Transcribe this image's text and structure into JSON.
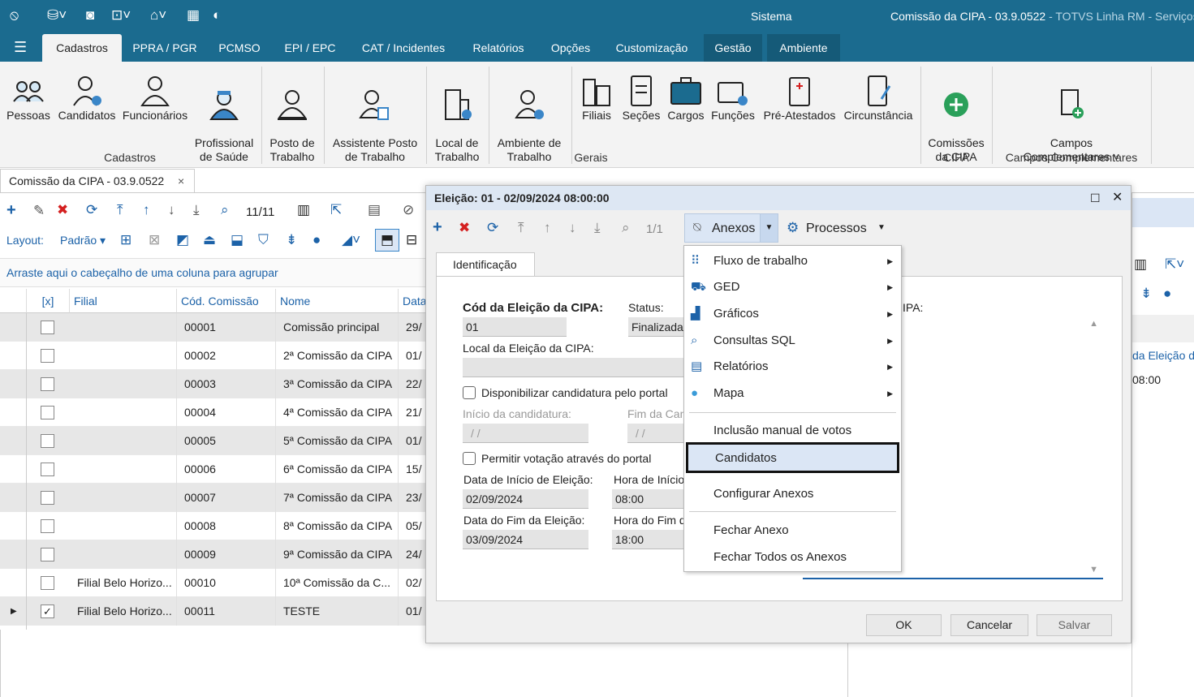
{
  "title_bar": {
    "center": "Sistema",
    "window_title": "Comissão da CIPA - 03.9.0522",
    "app_suffix": " - TOTVS Linha RM - Serviços"
  },
  "menu_tabs": [
    "Cadastros",
    "PPRA / PGR",
    "PCMSO",
    "EPI / EPC",
    "CAT / Incidentes",
    "Relatórios",
    "Opções",
    "Customização",
    "Gestão",
    "Ambiente"
  ],
  "ribbon": {
    "buttons": [
      {
        "label": "Pessoas",
        "icon": "people-icon"
      },
      {
        "label": "Candidatos",
        "icon": "candidate-icon"
      },
      {
        "label": "Funcionários",
        "icon": "employee-icon"
      },
      {
        "label": "Profissional\nde Saúde",
        "icon": "doctor-icon"
      },
      {
        "label": "Posto de\nTrabalho",
        "icon": "workstation-icon"
      },
      {
        "label": "Assistente Posto\nde Trabalho",
        "icon": "wizard-icon"
      },
      {
        "label": "Local de\nTrabalho",
        "icon": "building-icon"
      },
      {
        "label": "Ambiente de\nTrabalho",
        "icon": "environment-icon"
      },
      {
        "label": "Filiais",
        "icon": "branch-icon"
      },
      {
        "label": "Seções",
        "icon": "section-icon"
      },
      {
        "label": "Cargos",
        "icon": "briefcase-icon"
      },
      {
        "label": "Funções",
        "icon": "function-icon"
      },
      {
        "label": "Pré-Atestados",
        "icon": "certificate-icon"
      },
      {
        "label": "Circunstância",
        "icon": "circumstance-icon"
      },
      {
        "label": "Comissões\nda CIPA",
        "icon": "add-circle-icon"
      },
      {
        "label": "Campos\nComplementares ˅",
        "icon": "doc-plus-icon"
      }
    ],
    "groups": [
      "Cadastros",
      "Gerais",
      "CIPA",
      "Campos Complementares"
    ]
  },
  "doc_tab": {
    "label": "Comissão da CIPA - 03.9.0522",
    "close": "×"
  },
  "main_toolbar": {
    "counter": "11/11",
    "layout_label": "Layout:",
    "layout_value": "Padrão ▾"
  },
  "group_hint": "Arraste aqui o cabeçalho de uma coluna para agrupar",
  "grid": {
    "columns": [
      "[x]",
      "Filial",
      "Cód. Comissão",
      "Nome",
      "Data"
    ],
    "rows": [
      {
        "filial": "",
        "cod": "00001",
        "nome": "Comissão principal",
        "data": "29/",
        "checked": false
      },
      {
        "filial": "",
        "cod": "00002",
        "nome": "2ª Comissão da CIPA",
        "data": "01/",
        "checked": false
      },
      {
        "filial": "",
        "cod": "00003",
        "nome": "3ª Comissão da CIPA",
        "data": "22/",
        "checked": false
      },
      {
        "filial": "",
        "cod": "00004",
        "nome": "4ª Comissão da CIPA",
        "data": "21/",
        "checked": false
      },
      {
        "filial": "",
        "cod": "00005",
        "nome": "5ª Comissão da CIPA",
        "data": "01/",
        "checked": false
      },
      {
        "filial": "",
        "cod": "00006",
        "nome": "6ª Comissão da CIPA",
        "data": "15/",
        "checked": false
      },
      {
        "filial": "",
        "cod": "00007",
        "nome": "7ª Comissão da CIPA",
        "data": "23/",
        "checked": false
      },
      {
        "filial": "",
        "cod": "00008",
        "nome": "8ª Comissão da CIPA",
        "data": "05/",
        "checked": false
      },
      {
        "filial": "",
        "cod": "00009",
        "nome": "9ª Comissão da CIPA",
        "data": "24/",
        "checked": false
      },
      {
        "filial": "Filial Belo Horizo...",
        "cod": "00010",
        "nome": "10ª Comissão da C...",
        "data": "02/",
        "checked": false
      },
      {
        "filial": "Filial Belo Horizo...",
        "cod": "00011",
        "nome": "TESTE",
        "data": "01/",
        "checked": true
      }
    ]
  },
  "right_panel": {
    "label": "IPA:",
    "col_header": "da Eleição da",
    "cell": "08:00"
  },
  "dialog": {
    "title": "Eleição: 01 - 02/09/2024 08:00:00",
    "counter": "1/1",
    "anexos": "Anexos",
    "processos": "Processos",
    "tab": "Identificação",
    "cod_label": "Cód da Eleição da CIPA:",
    "cod_value": "01",
    "status_label": "Status:",
    "status_value": "Finalizada",
    "local_label": "Local da Eleição da CIPA:",
    "disp_label": "Disponibilizar candidatura pelo portal",
    "inicio_cand_label": "Início da candidatura:",
    "inicio_cand_value": "/ /",
    "fim_cand_label": "Fim da Can",
    "fim_cand_value": "/ /",
    "permitir_label": "Permitir votação através do portal",
    "data_inicio_label": "Data de Início de Eleição:",
    "data_inicio_value": "02/09/2024",
    "hora_inicio_label": "Hora de Início",
    "hora_inicio_value": "08:00",
    "data_fim_label": "Data do Fim da Eleição:",
    "data_fim_value": "03/09/2024",
    "hora_fim_label": "Hora do Fim d",
    "hora_fim_value": "18:00",
    "ok": "OK",
    "cancelar": "Cancelar",
    "salvar": "Salvar"
  },
  "context_menu": {
    "items": [
      {
        "label": "Fluxo de trabalho",
        "icon": "workflow-icon",
        "submenu": true
      },
      {
        "label": "GED",
        "icon": "ged-icon",
        "submenu": true
      },
      {
        "label": "Gráficos",
        "icon": "chart-icon",
        "submenu": true
      },
      {
        "label": "Consultas SQL",
        "icon": "search-icon",
        "submenu": true
      },
      {
        "label": "Relatórios",
        "icon": "report-icon",
        "submenu": true
      },
      {
        "label": "Mapa",
        "icon": "map-pin-icon",
        "submenu": true
      },
      {
        "label": "Inclusão manual de votos",
        "submenu": false
      },
      {
        "label": "Candidatos",
        "submenu": false,
        "highlighted": true
      },
      {
        "label": "Configurar Anexos",
        "submenu": false
      },
      {
        "label": "Fechar Anexo",
        "submenu": false
      },
      {
        "label": "Fechar Todos os Anexos",
        "submenu": false
      }
    ]
  },
  "colors": {
    "brand": "#1b6b8f",
    "accent": "#1c62a8",
    "highlight": "#dbe6f5",
    "danger": "#d42020",
    "success": "#2aa05a"
  }
}
